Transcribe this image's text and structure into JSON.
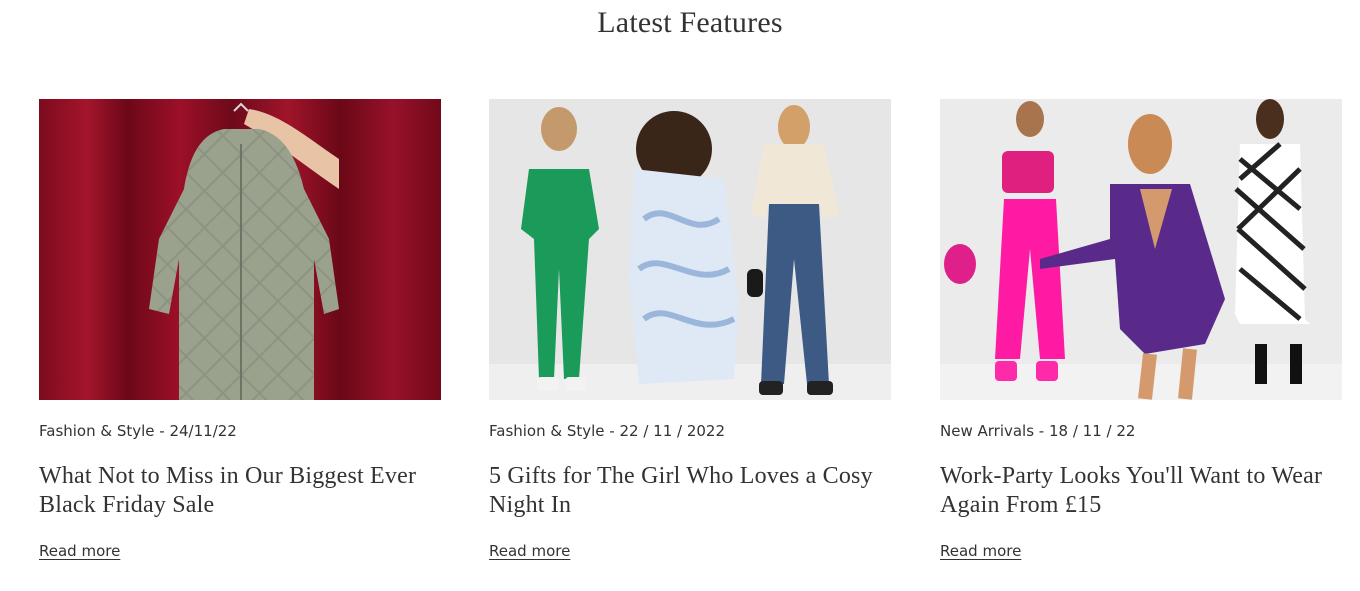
{
  "section": {
    "title": "Latest Features"
  },
  "cards": [
    {
      "meta": "Fashion & Style - 24/11/22",
      "title": "What Not to Miss in Our Biggest Ever Black Friday Sale",
      "link": "Read more",
      "image": "quilted-coat-red-curtain-photo"
    },
    {
      "meta": "Fashion & Style - 22 / 11 / 2022",
      "title": "5 Gifts for The Girl Who Loves a Cosy Night In",
      "link": "Read more",
      "image": "three-models-loungewear-photo"
    },
    {
      "meta": "New Arrivals - 18 / 11 / 22",
      "title": "Work-Party Looks You'll Want to Wear Again From £15",
      "link": "Read more",
      "image": "three-models-partywear-photo"
    }
  ]
}
